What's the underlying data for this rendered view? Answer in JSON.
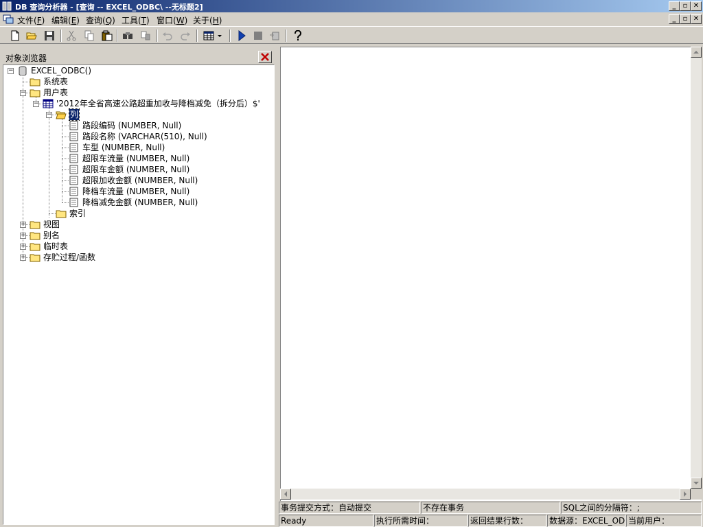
{
  "window": {
    "title": "DB 查询分析器 - [查询 -- EXCEL_ODBC\\  --无标题2]"
  },
  "menu": [
    {
      "label": "文件(",
      "key": "F",
      "end": ")"
    },
    {
      "label": "编辑(",
      "key": "E",
      "end": ")"
    },
    {
      "label": "查询(",
      "key": "Q",
      "end": ")"
    },
    {
      "label": "工具(",
      "key": "T",
      "end": ")"
    },
    {
      "label": "窗口(",
      "key": "W",
      "end": ")"
    },
    {
      "label": "关于(",
      "key": "H",
      "end": ")"
    }
  ],
  "toolbar": {
    "icons": [
      "new-file-icon",
      "open-folder-icon",
      "save-icon",
      "cut-icon",
      "copy-icon",
      "paste-icon",
      "find-icon",
      "replace-icon",
      "undo-icon",
      "redo-icon",
      "grid-icon",
      "dropdown-arrow-icon",
      "run-icon",
      "stop-icon",
      "parse-icon",
      "help-icon"
    ]
  },
  "object_browser": {
    "title": "对象浏览器",
    "tree": {
      "root": "EXCEL_ODBC()",
      "system_tables": "系统表",
      "user_tables": "用户表",
      "table": "'2012年全省高速公路超重加收与降档减免（拆分后）$'",
      "columns_folder": "列",
      "columns": [
        "路段编码 (NUMBER, Null)",
        "路段名称 (VARCHAR(510), Null)",
        "车型 (NUMBER, Null)",
        "超限车流量 (NUMBER, Null)",
        "超限车金额 (NUMBER, Null)",
        "超限加收金额 (NUMBER, Null)",
        "降档车流量 (NUMBER, Null)",
        "降档减免金额 (NUMBER, Null)"
      ],
      "index_folder": "索引",
      "views": "视图",
      "aliases": "别名",
      "temp_tables": "临时表",
      "procedures": "存贮过程/函数"
    }
  },
  "editor": {
    "content": ""
  },
  "status": {
    "commit_mode": "事务提交方式：自动提交",
    "transaction": "不存在事务",
    "separator": "SQL之间的分隔符：;",
    "ready": "Ready",
    "exec_time": "执行所需时间：",
    "rows": "返回结果行数：",
    "datasource": "数据源：EXCEL_ODBC",
    "user": "当前用户："
  },
  "colors": {
    "titlebar_start": "#0a246a",
    "titlebar_end": "#a6caf0",
    "face": "#d4d0c8",
    "folder": "#ffe680"
  }
}
